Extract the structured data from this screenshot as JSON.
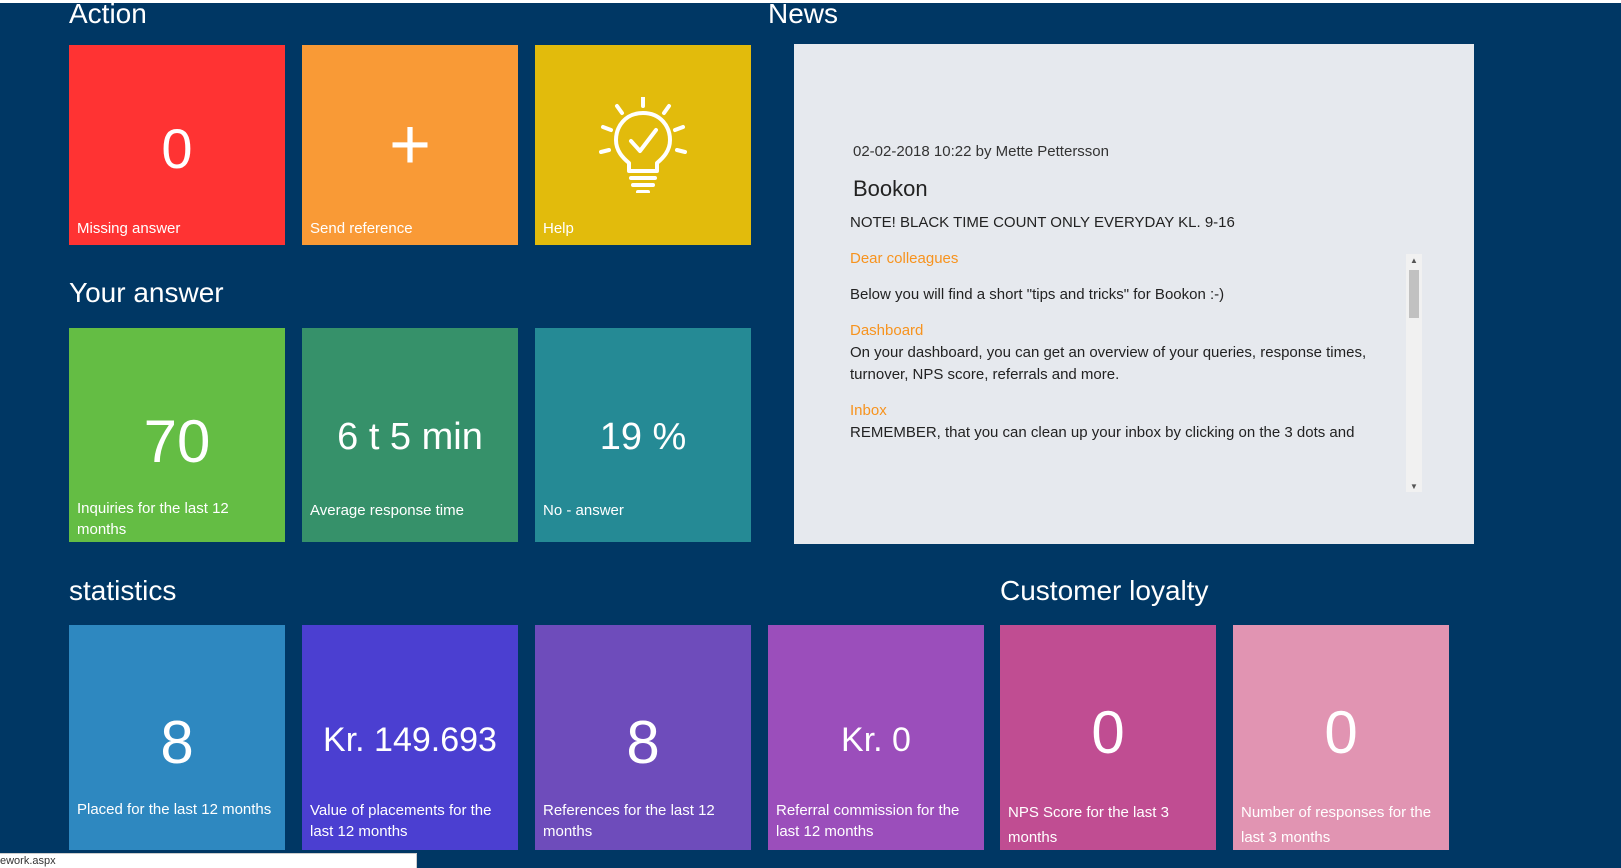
{
  "sections": {
    "action": "Action",
    "news": "News",
    "your_answer": "Your answer",
    "statistics": "statistics",
    "customer_loyalty": "Customer loyalty"
  },
  "action_tiles": [
    {
      "value": "0",
      "label": "Missing answer",
      "color": "#ff3333"
    },
    {
      "value": "+",
      "label": "Send reference",
      "color": "#f99a36"
    },
    {
      "icon": "lightbulb-check-icon",
      "label": "Help",
      "color": "#e2bb0c"
    }
  ],
  "answer_tiles": [
    {
      "value": "70",
      "label": "Inquiries for the last 12 months",
      "color": "#64bd44"
    },
    {
      "value": "6 t 5 min",
      "label": "Average response time",
      "color": "#36916a"
    },
    {
      "value": "19 %",
      "label": "No - answer",
      "color": "#258a95"
    }
  ],
  "statistics_tiles": [
    {
      "value": "8",
      "label": "Placed for the last 12 months",
      "color": "#2e88c0"
    },
    {
      "value": "Kr. 149.693",
      "label": "Value of placements for the last 12 months",
      "color": "#4b3fd1"
    },
    {
      "value": "8",
      "label": "References for the last 12 months",
      "color": "#6e4cbb"
    },
    {
      "value": "Kr. 0",
      "label": "Referral commission for the last 12 months",
      "color": "#9b4ebb"
    }
  ],
  "loyalty_tiles": [
    {
      "value": "0",
      "label": "NPS Score for the last 3 months",
      "color": "#c04d92"
    },
    {
      "value": "0",
      "label": "Number of responses for the last 3 months",
      "color": "#e194b2"
    }
  ],
  "news": {
    "meta": "02-02-2018 10:22 by Mette Pettersson",
    "title": "Bookon",
    "note": "NOTE! BLACK TIME COUNT ONLY EVERYDAY KL. 9-16",
    "greeting": "Dear colleagues",
    "intro": "Below you will find a short \"tips and tricks\" for Bookon :-)",
    "dashboard_heading": "Dashboard",
    "dashboard_text": "On your dashboard, you can get an overview of your queries, response times, turnover, NPS score, referrals and more.",
    "inbox_heading": "Inbox",
    "inbox_text": "REMEMBER, that you can clean up your inbox by clicking on the 3 dots and"
  },
  "status_url": "ework.aspx"
}
